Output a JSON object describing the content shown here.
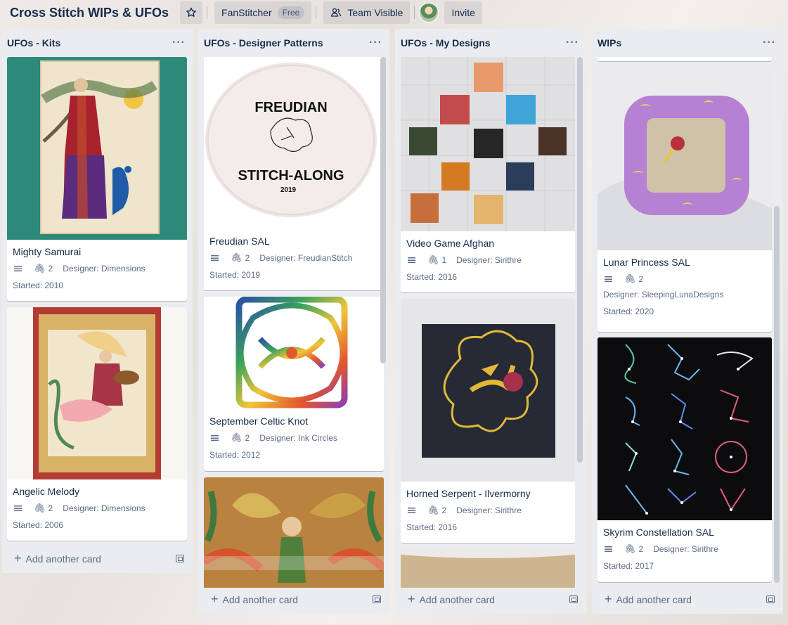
{
  "header": {
    "board_title": "Cross Stitch WIPs & UFOs",
    "workspace": "FanStitcher",
    "workspace_plan": "Free",
    "visibility": "Team Visible",
    "invite": "Invite"
  },
  "common": {
    "add_card": "Add another card"
  },
  "lists": [
    {
      "title": "UFOs - Kits",
      "cards": [
        {
          "title": "Mighty Samurai",
          "attachments": "2",
          "designer": "Designer: Dimensions",
          "started": "Started: 2010"
        },
        {
          "title": "Angelic Melody",
          "attachments": "2",
          "designer": "Designer: Dimensions",
          "started": "Started: 2006"
        }
      ]
    },
    {
      "title": "UFOs - Designer Patterns",
      "cards": [
        {
          "title": "Freudian SAL",
          "attachments": "2",
          "designer": "Designer: FreudianStitch",
          "started": "Started: 2019",
          "cover_text_top": "FREUDIAN",
          "cover_text_bottom": "STITCH-ALONG",
          "cover_text_year": "2019"
        },
        {
          "title": "September Celtic Knot",
          "attachments": "2",
          "designer": "Designer: Ink Circles",
          "started": "Started: 2012"
        }
      ]
    },
    {
      "title": "UFOs - My Designs",
      "cards": [
        {
          "title": "Video Game Afghan",
          "attachments": "1",
          "designer": "Designer: Sirithre",
          "started": "Started: 2016"
        },
        {
          "title": "Horned Serpent - Ilvermorny",
          "attachments": "2",
          "designer": "Designer: Sirithre",
          "started": "Started: 2016"
        }
      ]
    },
    {
      "title": "WIPs",
      "cards": [
        {
          "title": "Lunar Princess SAL",
          "attachments": "2",
          "designer": "Designer: SleepingLunaDesigns",
          "started": "Started: 2020"
        },
        {
          "title": "Skyrim Constellation SAL",
          "attachments": "2",
          "designer": "Designer: Sirithre",
          "started": "Started: 2017"
        }
      ]
    }
  ]
}
